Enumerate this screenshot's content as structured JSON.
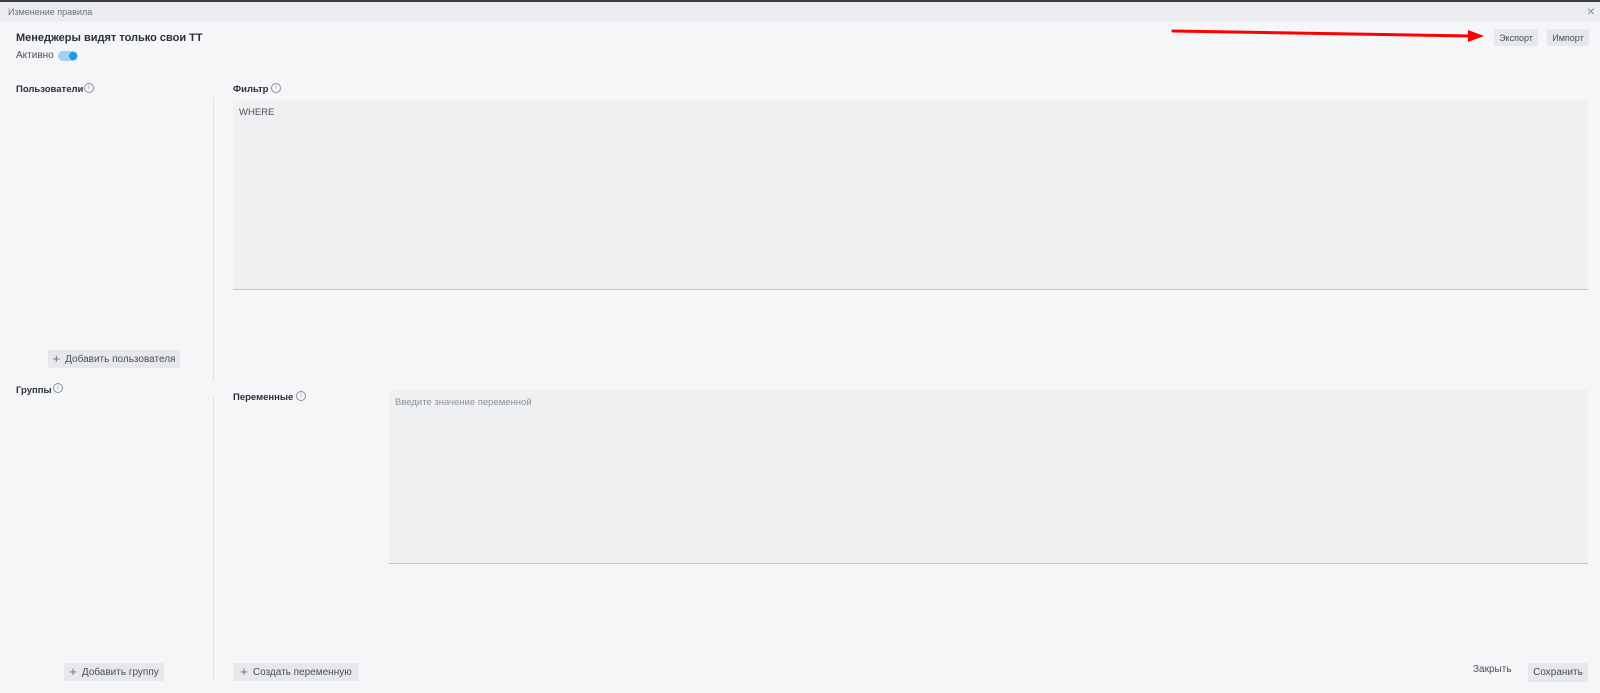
{
  "window": {
    "title": "Изменение правила"
  },
  "rule": {
    "name": "Менеджеры видят только свои ТТ",
    "active_label": "Активно",
    "active": true
  },
  "toolbar": {
    "export_label": "Экспорт",
    "import_label": "Импорт"
  },
  "users": {
    "label": "Пользователи",
    "add_label": "Добавить пользователя"
  },
  "groups": {
    "label": "Группы",
    "add_label": "Добавить группу"
  },
  "filter": {
    "label": "Фильтр",
    "value": "WHERE"
  },
  "variables": {
    "label": "Переменные",
    "placeholder": "Введите значение переменной",
    "create_label": "Создать переменную"
  },
  "footer": {
    "close_label": "Закрыть",
    "save_label": "Сохранить"
  },
  "annotation": {
    "arrow_color": "#ff0000"
  },
  "colors": {
    "accent": "#1e96e6",
    "toggle_track": "#9fd3f5"
  }
}
